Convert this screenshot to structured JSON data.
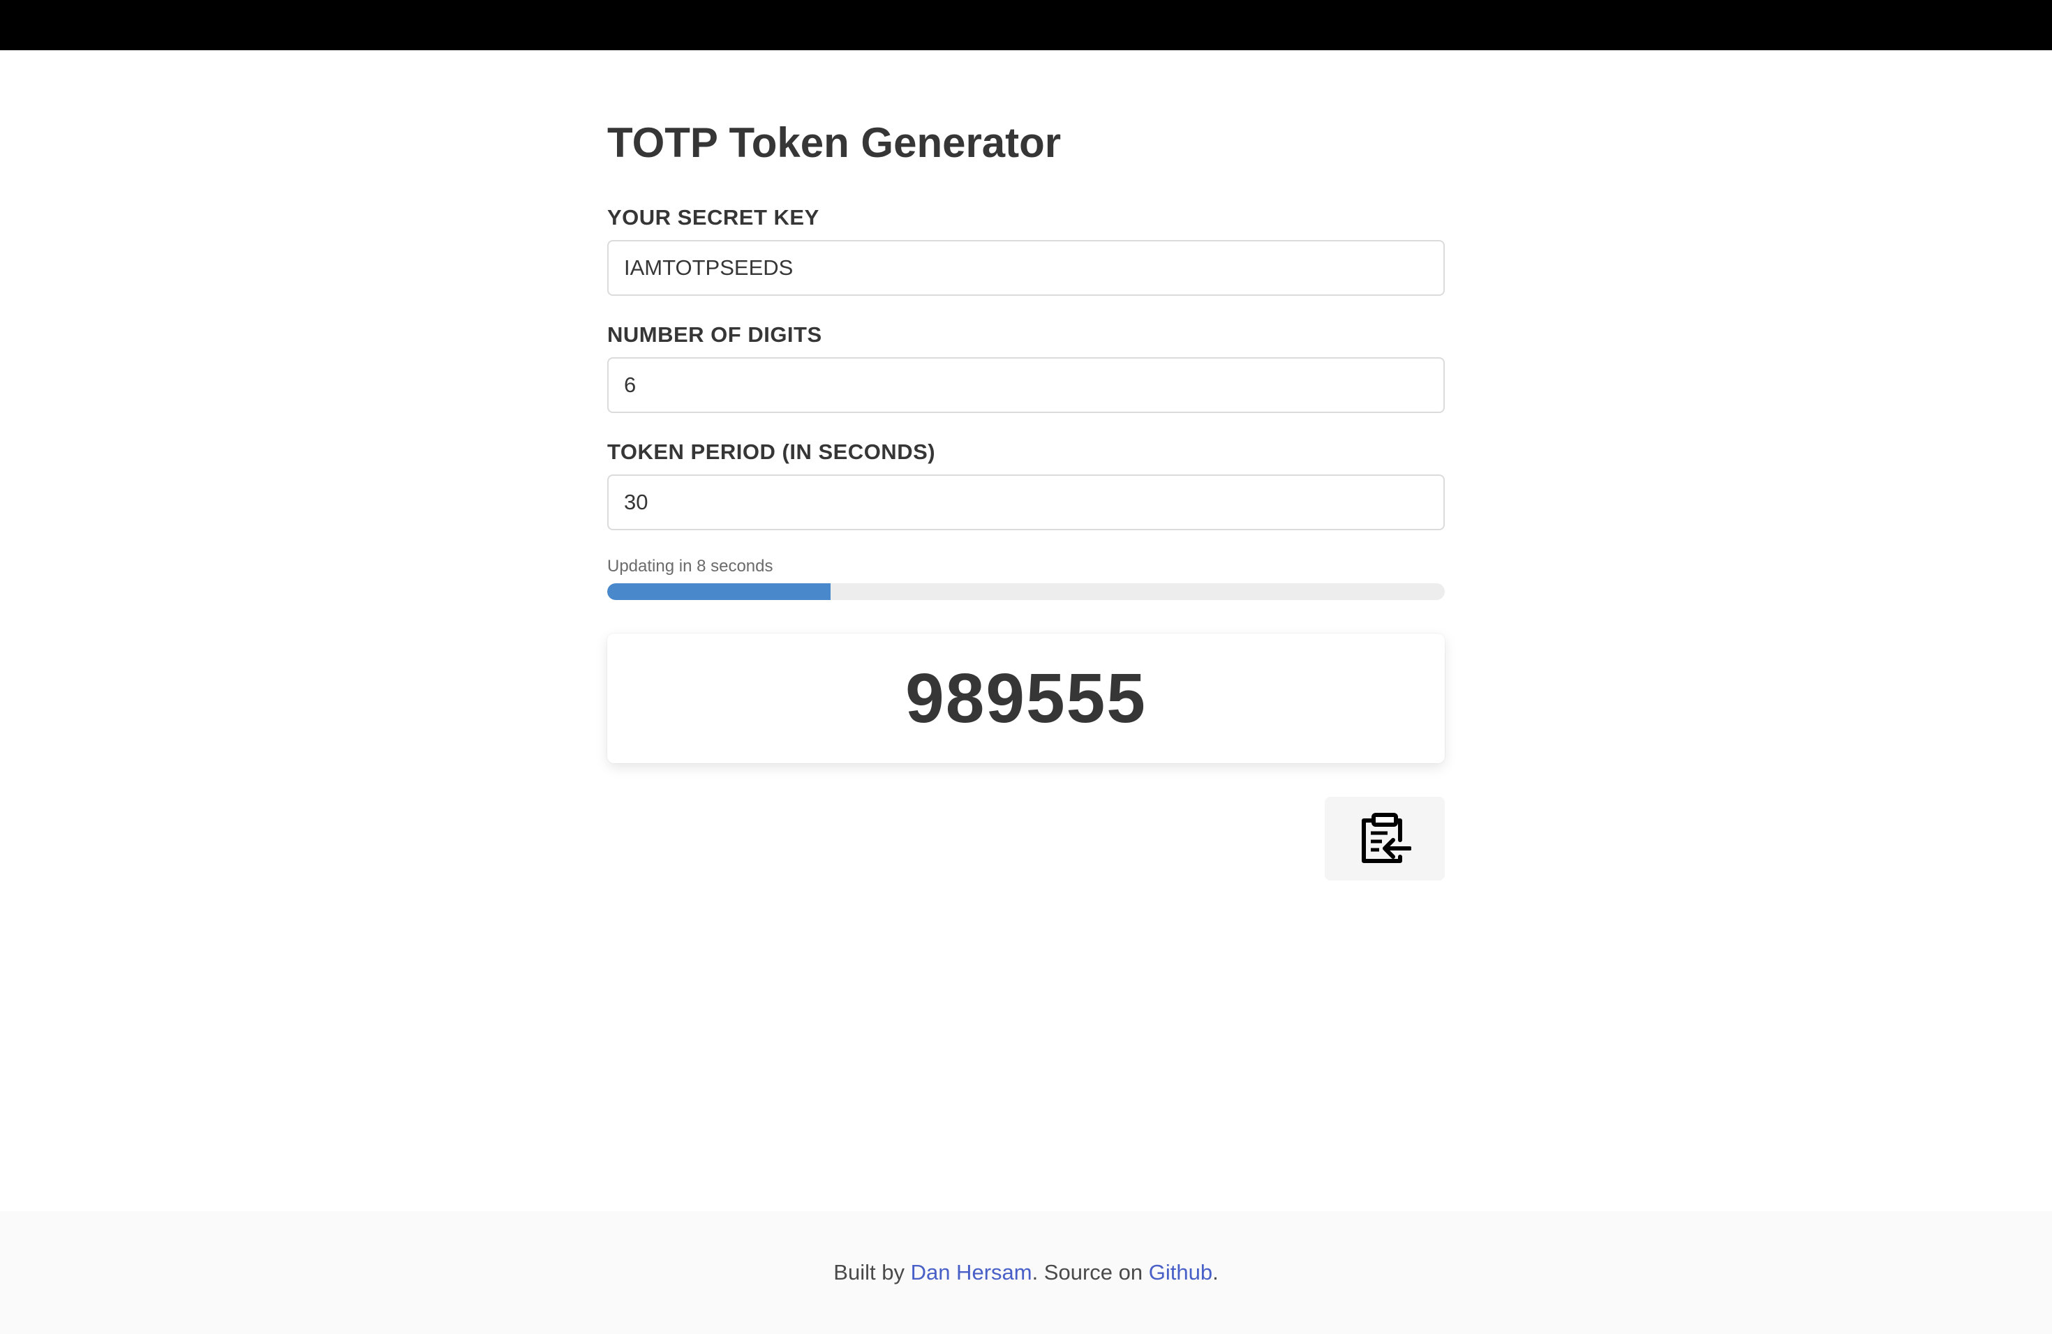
{
  "header": {
    "title": "TOTP Token Generator"
  },
  "form": {
    "secret_label": "YOUR SECRET KEY",
    "secret_value": "IAMTOTPSEEDS",
    "digits_label": "NUMBER OF DIGITS",
    "digits_value": "6",
    "period_label": "TOKEN PERIOD (IN SECONDS)",
    "period_value": "30"
  },
  "progress": {
    "text": "Updating in 8 seconds",
    "percent": 26.7,
    "color": "#4a88cc"
  },
  "token": {
    "value": "989555"
  },
  "copy_button": {
    "icon": "clipboard-copy-icon"
  },
  "footer": {
    "prefix": "Built by ",
    "author_link": "Dan Hersam",
    "middle": ". Source on ",
    "source_link": "Github",
    "suffix": "."
  }
}
